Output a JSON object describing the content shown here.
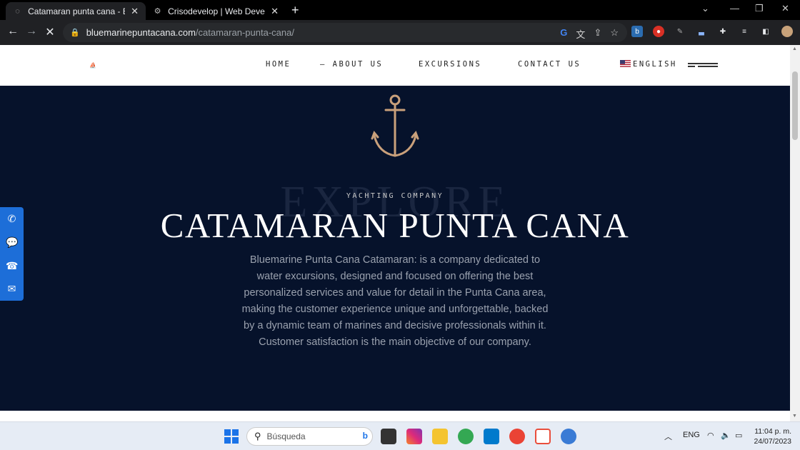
{
  "browser": {
    "tabs": [
      {
        "title": "Catamaran punta cana - Blueman",
        "active": true
      },
      {
        "title": "Crisodevelop | Web Developmen",
        "active": false
      }
    ],
    "url_domain": "bluemarinepuntacana.com",
    "url_path": "/catamaran-punta-cana/"
  },
  "site": {
    "menu": [
      "HOME",
      "ABOUT US",
      "EXCURSIONS",
      "CONTACT US"
    ],
    "language": "ENGLISH"
  },
  "hero": {
    "watermark": "EXPLORE",
    "kicker": "YACHTING COMPANY",
    "headline": "CATAMARAN PUNTA CANA",
    "description": "Bluemarine Punta Cana Catamaran: is a company dedicated to water excursions, designed and focused on offering the best personalized services and value for detail in the Punta Cana area, making the customer experience unique and unforgettable, backed by a dynamic team of marines and decisive professionals within it. Customer satisfaction is the main objective of our company."
  },
  "colors": {
    "hero_bg": "#06122b",
    "anchor": "#c9a07b",
    "contact_bar": "#1d6ed8"
  },
  "taskbar": {
    "search_placeholder": "Búsqueda",
    "lang": "ENG",
    "time": "11:04 p. m.",
    "date": "24/07/2023"
  }
}
